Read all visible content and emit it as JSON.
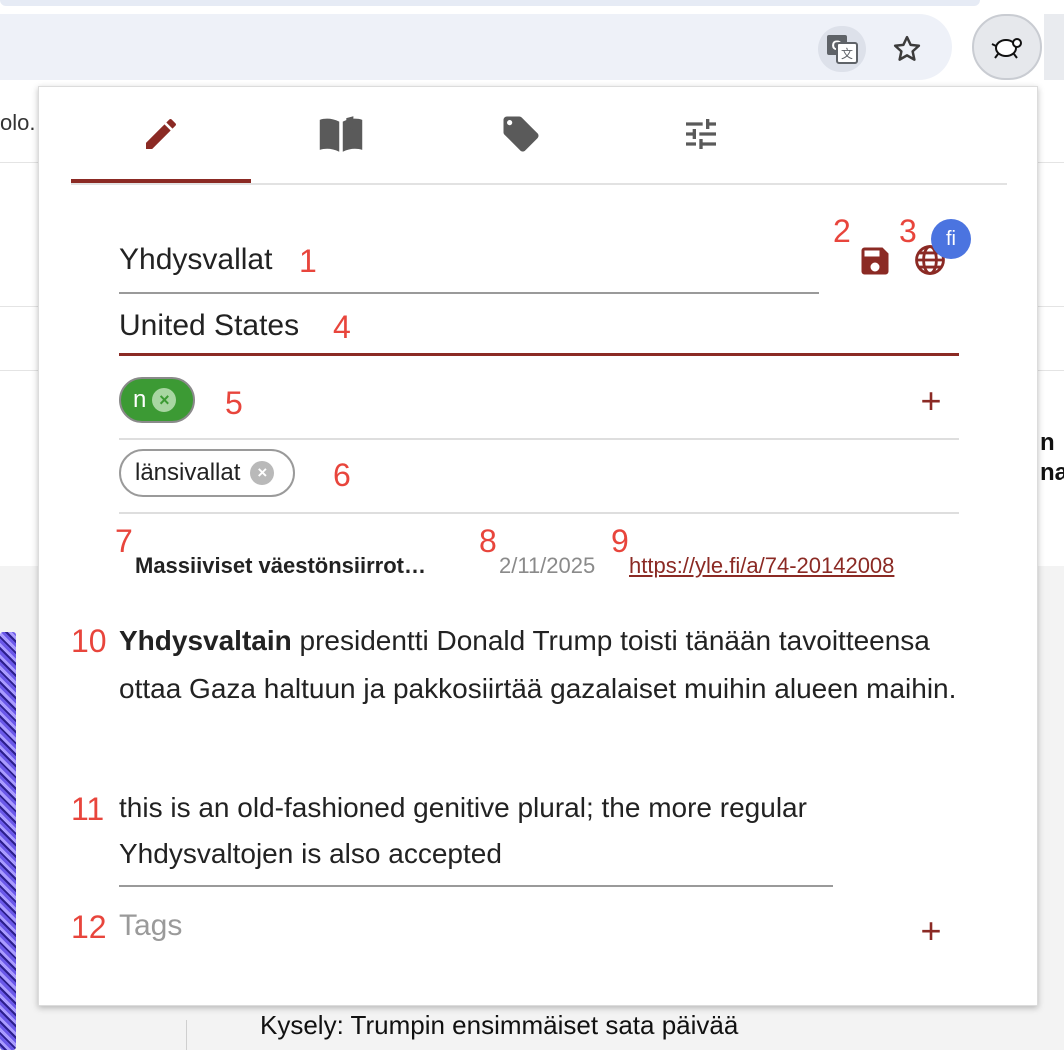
{
  "browser": {
    "translate_icon": "google-translate-icon",
    "star_icon": "star-icon",
    "extension_icon": "turtle-icon"
  },
  "background": {
    "partial_text": "olo.",
    "right_edge_text_1": "n",
    "right_edge_text_2": "na",
    "bottom_headline": "Kysely: Trumpin ensimmäiset sata päivää"
  },
  "popup": {
    "tabs": [
      {
        "name": "edit",
        "icon": "pencil-icon",
        "active": true
      },
      {
        "name": "book",
        "icon": "book-icon",
        "active": false
      },
      {
        "name": "tags",
        "icon": "tag-icon",
        "active": false
      },
      {
        "name": "settings",
        "icon": "sliders-icon",
        "active": false
      }
    ],
    "word": "Yhdysvallat",
    "translation": "United States",
    "language_badge": "fi",
    "pos_chip": "n",
    "tag_chip": "länsivallat",
    "source": {
      "title": "Massiiviset väestönsiirrot…",
      "date": "2/11/2025",
      "url": "https://yle.fi/a/74-20142008"
    },
    "context_bold": "Yhdysvaltain",
    "context_rest": " presidentti Donald Trump toisti tänään tavoitteensa ottaa Gaza haltuun ja pakkosiirtää gazalaiset muihin alueen maihin.",
    "note": "this is an old-fashioned genitive plural; the more regular Yhdysvaltojen is also accepted",
    "tags_placeholder": "Tags",
    "plus_symbol": "+",
    "chip_remove_symbol": "×",
    "accent_color": "#8b2a24",
    "number_color": "#e8453c"
  },
  "annotations": [
    "1",
    "2",
    "3",
    "4",
    "5",
    "6",
    "7",
    "8",
    "9",
    "10",
    "11",
    "12"
  ]
}
